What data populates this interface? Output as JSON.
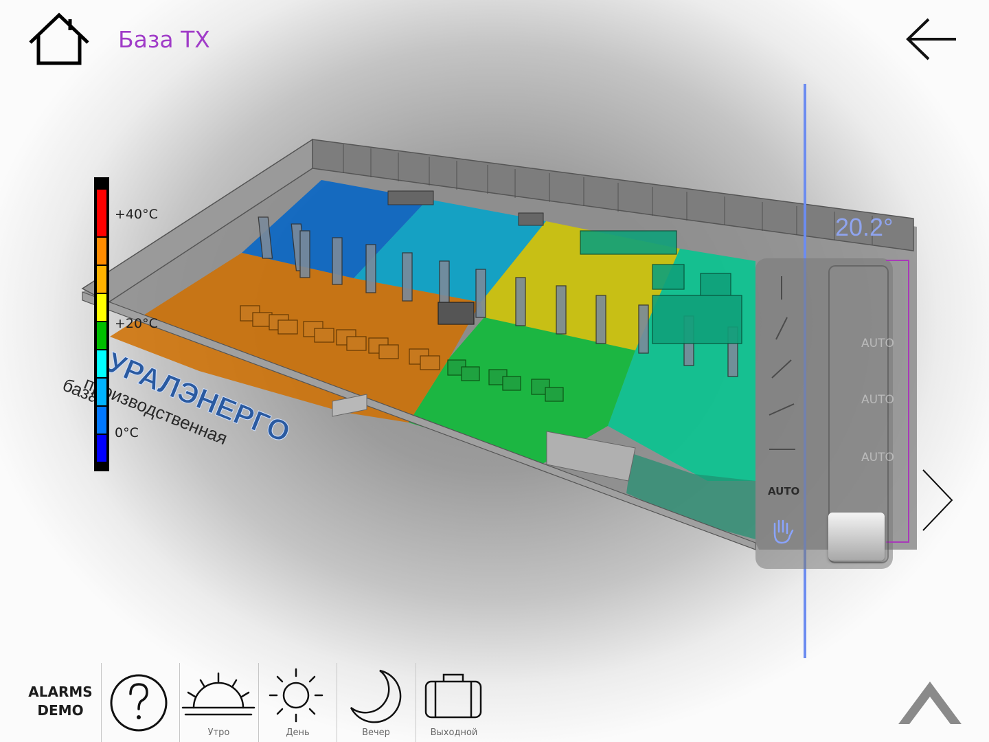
{
  "header": {
    "title": "База ТХ",
    "home_icon": "home-icon",
    "back_icon": "arrow-left-icon"
  },
  "legend": {
    "labels": [
      "+40°C",
      "+20°C",
      "0°C"
    ],
    "colors": [
      "#ff0000",
      "#ff8c00",
      "#ffb300",
      "#ffff00",
      "#00c000",
      "#00ffff",
      "#00b4ff",
      "#0078ff",
      "#0000ff"
    ]
  },
  "floorplan": {
    "sign_line1": "УРАЛЭНЕРГО",
    "sign_line2": "производственная",
    "sign_line3": "база"
  },
  "thermostat": {
    "temperature": "20.2°",
    "mode_auto_label": "AUTO",
    "fan_levels": [
      "AUTO",
      "AUTO",
      "AUTO"
    ],
    "accent_color": "#6c8cf0",
    "bracket_color": "#a83ab8"
  },
  "bottom": {
    "alarms_line1": "ALARMS",
    "alarms_line2": "DEMO",
    "scenes": [
      {
        "label": "Утро",
        "icon": "sunrise-icon"
      },
      {
        "label": "День",
        "icon": "sun-icon"
      },
      {
        "label": "Вечер",
        "icon": "moon-icon"
      },
      {
        "label": "Выходной",
        "icon": "suitcase-icon"
      }
    ]
  }
}
